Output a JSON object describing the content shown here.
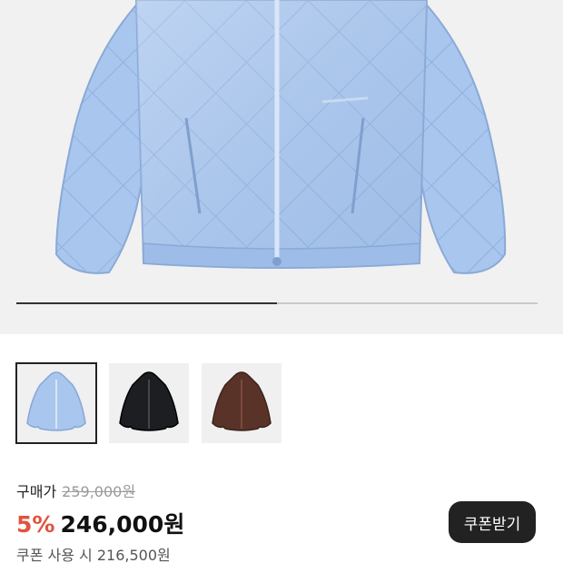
{
  "product": {
    "image_slider": {
      "current_fraction": 0.5
    },
    "thumbnails": [
      {
        "color": "light-blue",
        "selected": true
      },
      {
        "color": "black",
        "selected": false
      },
      {
        "color": "brown",
        "selected": false
      }
    ]
  },
  "pricing": {
    "purchase_label": "구매가",
    "original_price": "259,000원",
    "discount_rate": "5%",
    "sale_price": "246,000원",
    "coupon_note": "쿠폰 사용 시 216,500원"
  },
  "actions": {
    "coupon_button_label": "쿠폰받기"
  },
  "colors": {
    "discount": "#e0533d",
    "button_bg": "#222222",
    "jacket_blue": "#a9c6ee"
  }
}
